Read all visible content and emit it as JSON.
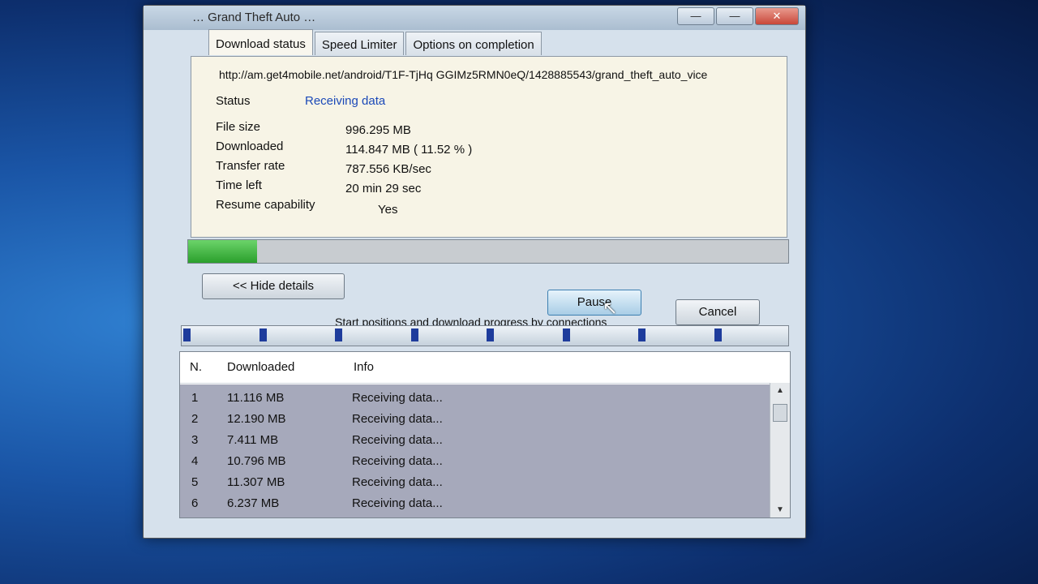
{
  "window": {
    "title": "… Grand Theft Auto …",
    "controls": {
      "minimize": "—",
      "maximize": "—",
      "close": "✕"
    }
  },
  "tabs": [
    {
      "label": "Download status",
      "active": true
    },
    {
      "label": "Speed Limiter",
      "active": false
    },
    {
      "label": "Options on completion",
      "active": false
    }
  ],
  "status": {
    "url": "http://am.get4mobile.net/android/T1F-TjHq GGIMz5RMN0eQ/1428885543/grand_theft_auto_vice",
    "status_label": "Status",
    "status_value": "Receiving data",
    "file_size_label": "File size",
    "file_size_value": "996.295  MB",
    "downloaded_label": "Downloaded",
    "downloaded_value": "114.847  MB  ( 11.52 % )",
    "transfer_rate_label": "Transfer rate",
    "transfer_rate_value": "787.556  KB/sec",
    "time_left_label": "Time left",
    "time_left_value": "20 min 29 sec",
    "resume_label": "Resume capability",
    "resume_value": "Yes"
  },
  "progress": {
    "fraction": 0.1152,
    "color": "#2a9f2c"
  },
  "buttons": {
    "hide_details": "<< Hide details",
    "pause": "Pause",
    "cancel": "Cancel"
  },
  "connections": {
    "label": "Start positions and download progress by connections",
    "starts": [
      0.0,
      0.125,
      0.25,
      0.375,
      0.5,
      0.625,
      0.75,
      0.875
    ]
  },
  "table": {
    "headers": {
      "n": "N.",
      "downloaded": "Downloaded",
      "info": "Info"
    },
    "rows": [
      {
        "n": "1",
        "downloaded": "11.116  MB",
        "info": "Receiving data..."
      },
      {
        "n": "2",
        "downloaded": "12.190  MB",
        "info": "Receiving data..."
      },
      {
        "n": "3",
        "downloaded": "7.411  MB",
        "info": "Receiving data..."
      },
      {
        "n": "4",
        "downloaded": "10.796  MB",
        "info": "Receiving data..."
      },
      {
        "n": "5",
        "downloaded": "11.307  MB",
        "info": "Receiving data..."
      },
      {
        "n": "6",
        "downloaded": "6.237  MB",
        "info": "Receiving data..."
      }
    ]
  },
  "icons": {
    "scroll_up": "scroll-up-arrow-icon",
    "scroll_down": "scroll-down-arrow-icon",
    "cursor": "mouse-cursor-icon"
  }
}
